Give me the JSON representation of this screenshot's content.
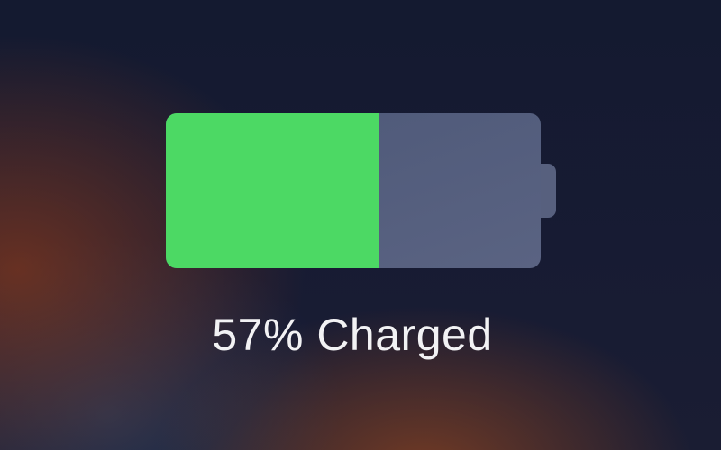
{
  "battery": {
    "level_percent": 57,
    "label": "57% Charged",
    "fill_color": "#4cd964",
    "empty_color": "#55607f"
  },
  "icons": {
    "battery": "battery-icon"
  }
}
